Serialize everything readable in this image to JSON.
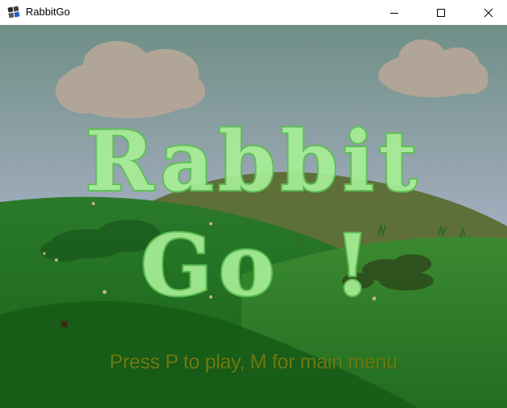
{
  "window": {
    "title": "RabbitGo",
    "controls": {
      "minimize": "minimize",
      "maximize": "maximize",
      "close": "close"
    }
  },
  "game": {
    "title_line1": "Rabbit",
    "title_line2": "Go",
    "title_exclaim": "!",
    "prompt": "Press P to play, M for main menu"
  },
  "colors": {
    "sky_top": "#6f8f86",
    "sky_bottom": "#c3c6ee",
    "cloud": "#b1a598",
    "hill_far": "#5e6f3a",
    "hill_near": "#1f6d22",
    "title_fill": "#a7ee96",
    "title_stroke": "#5cc152",
    "prompt_text": "#6b7a12"
  },
  "icons": {
    "app": "rabbitgo-app-icon",
    "minimize": "minimize-icon",
    "maximize": "maximize-icon",
    "close": "close-icon"
  }
}
